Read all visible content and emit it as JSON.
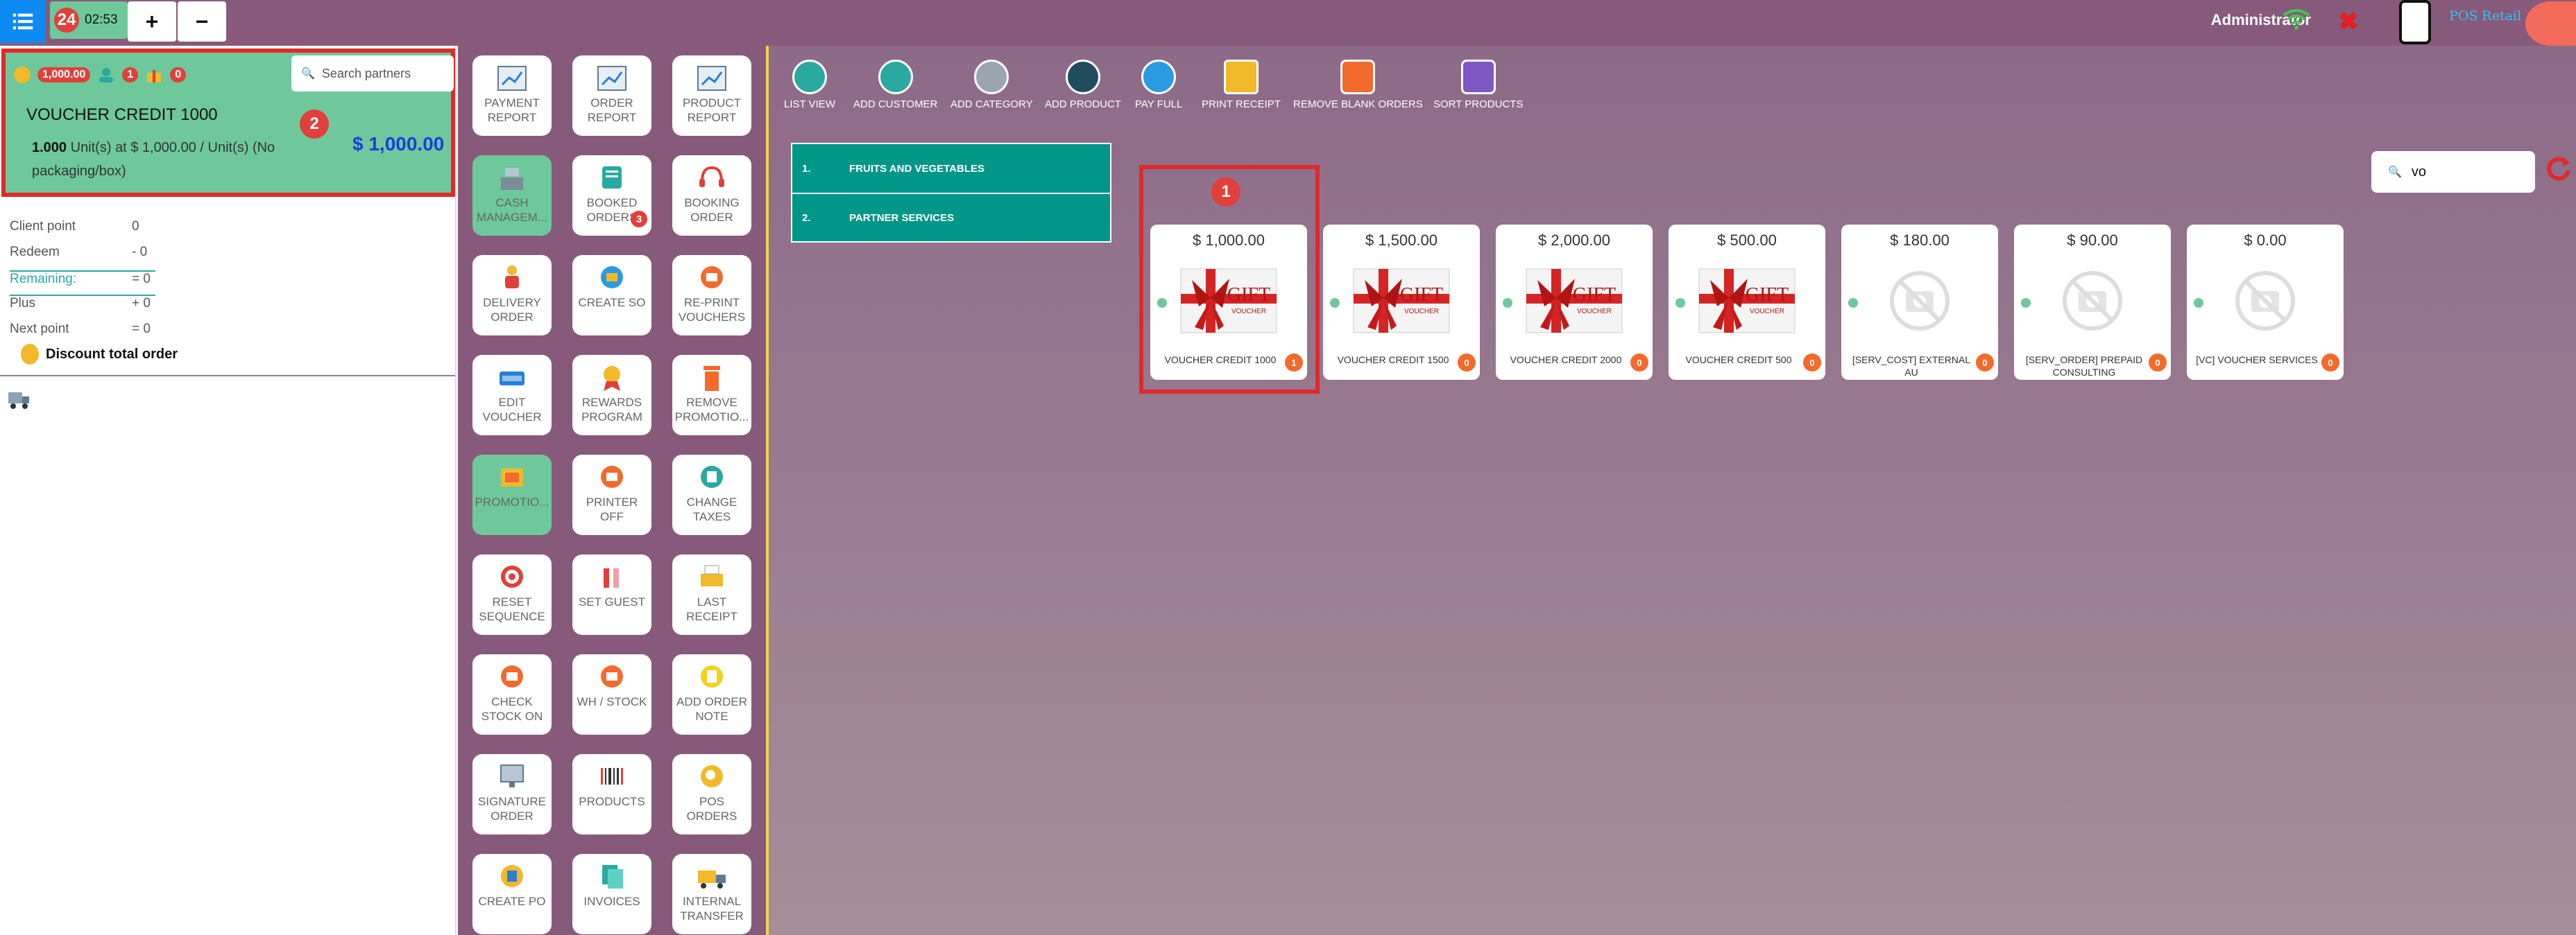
{
  "topbar": {
    "order_number": "24",
    "order_time": "02:53",
    "add_label": "+",
    "remove_label": "−",
    "user_name": "Administrator",
    "close_symbol": "✖",
    "brand": "POS Retail"
  },
  "order_panel": {
    "points_badge": "1,000.00",
    "customer_badge": "1",
    "gift_badge": "0",
    "search_placeholder": "Search partners",
    "selected_line": {
      "name": "VOUCHER CREDIT 1000",
      "qty": "1.000",
      "detail": " Unit(s) at $ 1,000.00 / Unit(s) (No packaging/box)",
      "price": "$ 1,000.00"
    },
    "annotation": "2",
    "points": [
      {
        "label": "Client point",
        "value": "0"
      },
      {
        "label": "Redeem",
        "value": "- 0"
      },
      {
        "label": "Remaining:",
        "value": "= 0"
      },
      {
        "label": "Plus",
        "value": "+ 0"
      },
      {
        "label": "Next point",
        "value": "= 0"
      }
    ],
    "discount_label": "Discount total order"
  },
  "actions": {
    "payment_report": "PAYMENT REPORT",
    "order_report": "ORDER REPORT",
    "product_report": "PRODUCT REPORT",
    "cash_management": "CASH MANAGEM...",
    "booked_orders": "BOOKED ORDERS",
    "booked_orders_count": "3",
    "booking_order": "BOOKING ORDER",
    "delivery_order": "DELIVERY ORDER",
    "create_so": "CREATE SO",
    "reprint_vouchers": "RE-PRINT VOUCHERS",
    "edit_voucher": "EDIT VOUCHER",
    "rewards_program": "REWARDS PROGRAM",
    "remove_promotion": "REMOVE PROMOTIO...",
    "promotion": "PROMOTIO...",
    "printer_off": "PRINTER OFF",
    "change_taxes": "CHANGE TAXES",
    "reset_sequence": "RESET SEQUENCE",
    "set_guest": "SET GUEST",
    "last_receipt": "LAST RECEIPT",
    "check_stock_on": "CHECK STOCK ON",
    "wh_stock": "WH / STOCK",
    "add_order_note": "ADD ORDER NOTE",
    "signature_order": "SIGNATURE ORDER",
    "products": "PRODUCTS",
    "pos_orders": "POS ORDERS",
    "create_po": "CREATE PO",
    "invoices": "INVOICES",
    "internal_transfer": "INTERNAL TRANSFER"
  },
  "controls": {
    "list_view": "LIST VIEW",
    "add_customer": "ADD CUSTOMER",
    "add_category": "ADD CATEGORY",
    "add_product": "ADD PRODUCT",
    "pay_full": "PAY FULL",
    "print_receipt": "PRINT RECEIPT",
    "remove_blank_orders": "REMOVE BLANK ORDERS",
    "sort_products": "SORT PRODUCTS"
  },
  "categories": [
    {
      "num": "1.",
      "name": "FRUITS AND VEGETABLES"
    },
    {
      "num": "2.",
      "name": "PARTNER SERVICES"
    }
  ],
  "product_search": {
    "value": "vo"
  },
  "product_annotation": "1",
  "products": [
    {
      "price": "$ 1,000.00",
      "name": "VOUCHER CREDIT 1000",
      "count": "1",
      "image": "gift-voucher"
    },
    {
      "price": "$ 1,500.00",
      "name": "VOUCHER CREDIT 1500",
      "count": "0",
      "image": "gift-voucher"
    },
    {
      "price": "$ 2,000.00",
      "name": "VOUCHER CREDIT 2000",
      "count": "0",
      "image": "gift-voucher"
    },
    {
      "price": "$ 500.00",
      "name": "VOUCHER CREDIT 500",
      "count": "0",
      "image": "gift-voucher"
    },
    {
      "price": "$ 180.00",
      "name": "[SERV_COST] EXTERNAL AU",
      "count": "0",
      "image": "no-image"
    },
    {
      "price": "$ 90.00",
      "name": "[SERV_ORDER] PREPAID CONSULTING",
      "count": "0",
      "image": "no-image"
    },
    {
      "price": "$ 0.00",
      "name": "[VC] VOUCHER SERVICES",
      "count": "0",
      "image": "no-image"
    }
  ],
  "colors": {
    "topbar": "#875a7b",
    "accent_green": "#6ec89b",
    "category_teal": "#009688",
    "badge_red": "#e0403a",
    "highlight_frame": "#e02929",
    "price_blue": "#1a3fe0"
  }
}
